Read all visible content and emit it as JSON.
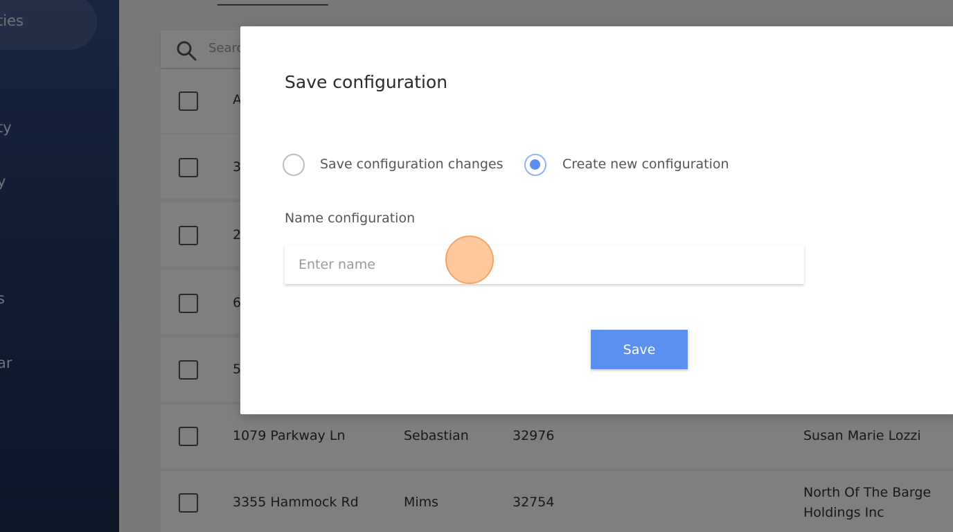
{
  "sidebar": {
    "items": [
      {
        "label": "ties"
      },
      {
        "label": "ty"
      },
      {
        "label": "y"
      },
      {
        "label": "s"
      },
      {
        "label": "ar"
      }
    ]
  },
  "search": {
    "placeholder": "Search"
  },
  "table": {
    "header_partial": "A",
    "rows_partial": [
      {
        "address": "3"
      },
      {
        "address": "2"
      },
      {
        "address": "6"
      },
      {
        "address": "5"
      }
    ],
    "rows": [
      {
        "address": "1079 Parkway Ln",
        "city": "Sebastian",
        "zip": "32976",
        "owner": "Susan Marie Lozzi",
        "owner2": ""
      },
      {
        "address": "3355 Hammock Rd",
        "city": "Mims",
        "zip": "32754",
        "owner": "North Of The Barge",
        "owner2": "Holdings Inc"
      }
    ]
  },
  "modal": {
    "title": "Save configuration",
    "options": [
      {
        "label": "Save configuration changes",
        "checked": false
      },
      {
        "label": "Create new configuration",
        "checked": true
      }
    ],
    "name_label": "Name configuration",
    "name_placeholder": "Enter name",
    "name_value": "",
    "save_label": "Save"
  },
  "colors": {
    "accent": "#5b8ff0",
    "sidebar": "#2d4a7c"
  }
}
